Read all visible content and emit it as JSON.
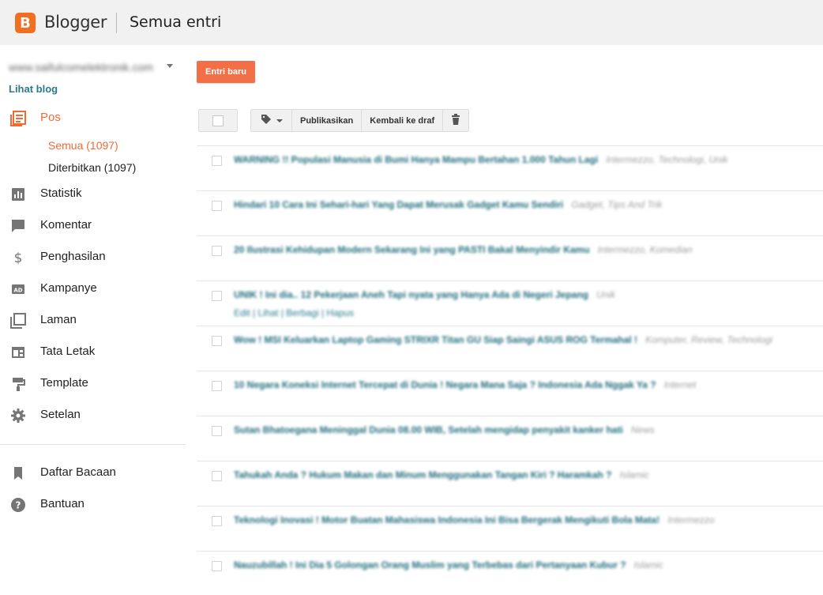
{
  "header": {
    "logo_letter": "B",
    "brand": "Blogger",
    "title": "Semua entri"
  },
  "sidebar": {
    "blog_selector": "www.saifulcomelektronik.com",
    "view_blog": "Lihat blog",
    "items": [
      {
        "id": "pos",
        "label": "Pos",
        "icon": "posts-icon",
        "active": true
      },
      {
        "id": "statistik",
        "label": "Statistik",
        "icon": "stats-icon"
      },
      {
        "id": "komentar",
        "label": "Komentar",
        "icon": "comment-icon"
      },
      {
        "id": "penghasilan",
        "label": "Penghasilan",
        "icon": "dollar-icon"
      },
      {
        "id": "kampanye",
        "label": "Kampanye",
        "icon": "ad-icon"
      },
      {
        "id": "laman",
        "label": "Laman",
        "icon": "pages-icon"
      },
      {
        "id": "tata-letak",
        "label": "Tata Letak",
        "icon": "layout-icon"
      },
      {
        "id": "template",
        "label": "Template",
        "icon": "paint-roller-icon"
      },
      {
        "id": "setelan",
        "label": "Setelan",
        "icon": "gear-icon"
      }
    ],
    "sub_items": [
      {
        "label": "Semua (1097)",
        "active": true
      },
      {
        "label": "Diterbitkan (1097)",
        "active": false
      }
    ],
    "bottom_items": [
      {
        "id": "daftar-bacaan",
        "label": "Daftar Bacaan",
        "icon": "bookmark-icon"
      },
      {
        "id": "bantuan",
        "label": "Bantuan",
        "icon": "help-icon"
      }
    ]
  },
  "main": {
    "new_post": "Entri baru",
    "toolbar": {
      "label_icon": "tag-icon",
      "publish": "Publikasikan",
      "revert": "Kembali ke draf",
      "delete_icon": "trash-icon"
    },
    "posts": [
      {
        "title": "WARNING !! Populasi Manusia di Bumi Hanya Mampu Bertahan 1.000 Tahun Lagi",
        "labels": "Intermezzo, Technologi, Unik"
      },
      {
        "title": "Hindari 10 Cara Ini Sehari-hari Yang Dapat Merusak Gadget Kamu Sendiri",
        "labels": "Gadget, Tips And Trik"
      },
      {
        "title": "20 Ilustrasi Kehidupan Modern Sekarang Ini yang PASTI Bakal Menyindir Kamu",
        "labels": "Intermezzo, Komedian"
      },
      {
        "title": "UNIK ! Ini dia.. 12 Pekerjaan Aneh Tapi nyata yang Hanya Ada di Negeri Jepang",
        "labels": "Unik",
        "actions": "Edit | Lihat | Berbagi | Hapus"
      },
      {
        "title": "Wow ! MSI Keluarkan Laptop Gaming STRIXR Titan GU Siap Saingi ASUS ROG Termahal !",
        "labels": "Komputer, Review, Technologi"
      },
      {
        "title": "10 Negara Koneksi Internet Tercepat di Dunia ! Negara Mana Saja ? Indonesia Ada Nggak Ya ?",
        "labels": "Internet"
      },
      {
        "title": "Sutan Bhatoegana Meninggal Dunia 08.00 WIB, Setelah mengidap penyakit kanker hati",
        "labels": "News"
      },
      {
        "title": "Tahukah Anda ? Hukum Makan dan Minum Menggunakan Tangan Kiri ? Haramkah ?",
        "labels": "Islamic"
      },
      {
        "title": "Teknologi Inovasi ! Motor Buatan Mahasiswa Indonesia Ini Bisa Bergerak Mengikuti Bola Mata!",
        "labels": "Intermezzo"
      },
      {
        "title": "Nauzubillah ! Ini Dia 5 Golongan Orang Muslim yang Terbebas dari Pertanyaan Kubur ?",
        "labels": "Islamic"
      }
    ]
  },
  "colors": {
    "accent": "#f06a35",
    "button": "#f26f47",
    "link": "#2a7b8c",
    "header_bg": "#f1f1f1"
  }
}
